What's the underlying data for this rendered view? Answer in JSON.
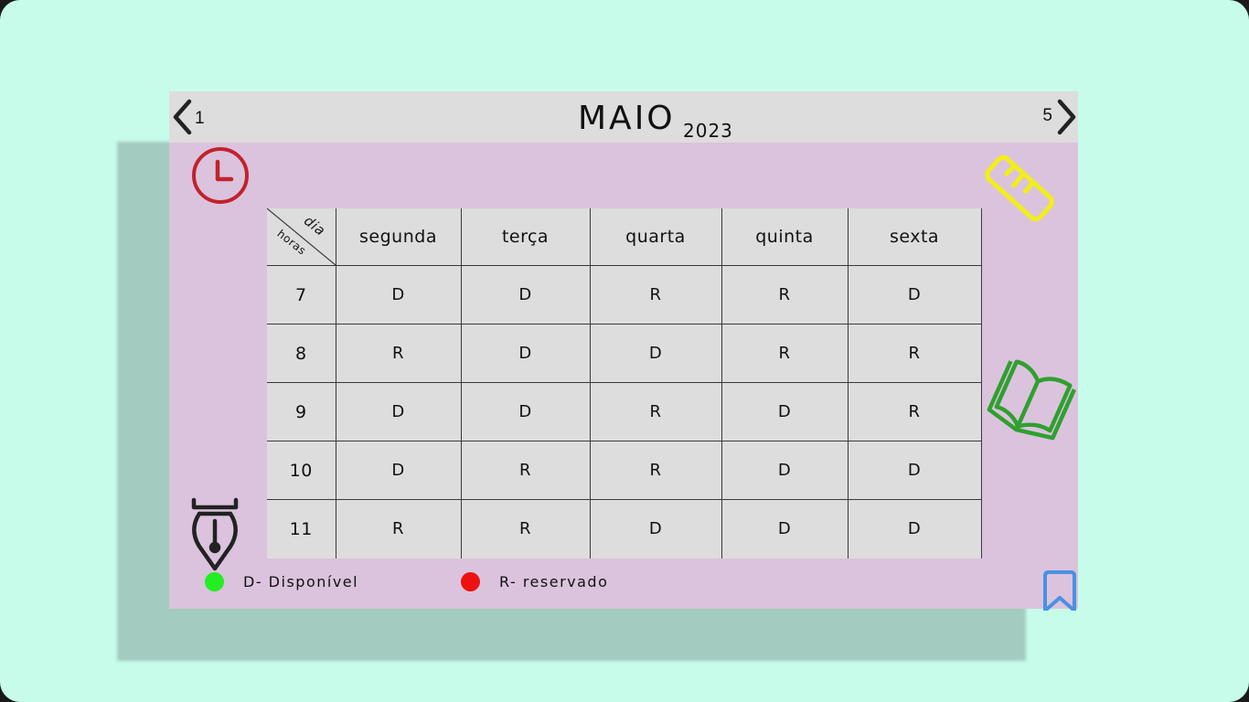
{
  "header": {
    "month": "MAIO",
    "year": "2023",
    "prev_label": "1",
    "next_label": "5"
  },
  "table": {
    "corner_top": "dia",
    "corner_bottom": "horas",
    "days": [
      "segunda",
      "terça",
      "quarta",
      "quinta",
      "sexta"
    ],
    "rows": [
      {
        "hour": "7",
        "cells": [
          "D",
          "D",
          "R",
          "R",
          "D"
        ]
      },
      {
        "hour": "8",
        "cells": [
          "R",
          "D",
          "D",
          "R",
          "R"
        ]
      },
      {
        "hour": "9",
        "cells": [
          "D",
          "D",
          "R",
          "D",
          "R"
        ]
      },
      {
        "hour": "10",
        "cells": [
          "D",
          "R",
          "R",
          "D",
          "D"
        ]
      },
      {
        "hour": "11",
        "cells": [
          "R",
          "R",
          "D",
          "D",
          "D"
        ]
      }
    ]
  },
  "legend": {
    "available": {
      "label": "D- Disponível",
      "color": "#22ee22"
    },
    "reserved": {
      "label": "R- reservado",
      "color": "#ee1111"
    }
  },
  "icons": {
    "clock": "clock-icon",
    "ruler": "ruler-icon",
    "book": "open-book-icon",
    "pen": "fountain-pen-icon",
    "bookmark": "bookmark-icon"
  },
  "colors": {
    "background": "#c7fcea",
    "card": "#dbc3dd",
    "header": "#dddddd",
    "clock": "#c0232b",
    "ruler": "#f2ee1a",
    "book": "#2fa02f",
    "bookmark": "#4a90e2"
  }
}
